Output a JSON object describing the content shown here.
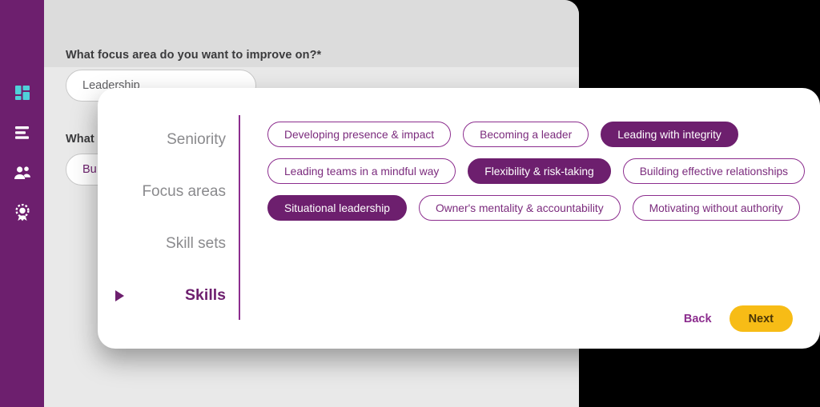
{
  "colors": {
    "brand_purple": "#6D1F6E",
    "chip_border": "#8C2D8E",
    "accent_yellow": "#F7BC16",
    "app_bg": "#DCDCDC",
    "panel_bg": "#E9E9E9",
    "page_bg": "#000000",
    "dashboard_icon_teal": "#4FD1D9"
  },
  "sidebar": {
    "items": [
      {
        "icon": "dashboard-grid-icon",
        "label": ""
      },
      {
        "icon": "list-lines-icon",
        "label": ""
      },
      {
        "icon": "people-group-icon",
        "label": ""
      },
      {
        "icon": "award-badge-icon",
        "label": ""
      }
    ]
  },
  "form": {
    "question1": {
      "label": "What focus area do you want to improve on?*",
      "value": "Leadership"
    },
    "question2": {
      "label": "What",
      "value": "Bu"
    }
  },
  "modal": {
    "steps": [
      {
        "label": "Seniority",
        "active": false
      },
      {
        "label": "Focus areas",
        "active": false
      },
      {
        "label": "Skill sets",
        "active": false
      },
      {
        "label": "Skills",
        "active": true
      }
    ],
    "chip_rows": [
      [
        {
          "label": "Developing presence & impact",
          "selected": false
        },
        {
          "label": "Becoming a leader",
          "selected": false
        },
        {
          "label": "Leading with integrity",
          "selected": true
        }
      ],
      [
        {
          "label": "Leading teams in a mindful way",
          "selected": false
        },
        {
          "label": "Flexibility & risk-taking",
          "selected": true
        },
        {
          "label": "Building effective relationships",
          "selected": false
        }
      ],
      [
        {
          "label": "Situational leadership",
          "selected": true
        },
        {
          "label": "Owner's mentality & accountability",
          "selected": false
        },
        {
          "label": "Motivating without authority",
          "selected": false
        }
      ]
    ],
    "footer": {
      "back_label": "Back",
      "next_label": "Next"
    }
  }
}
